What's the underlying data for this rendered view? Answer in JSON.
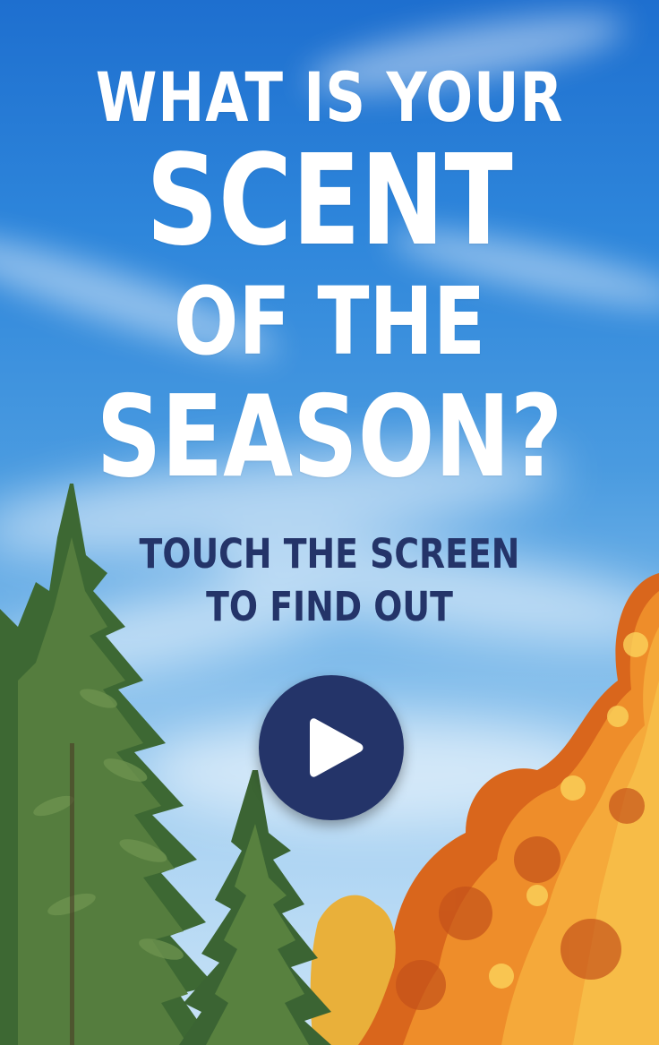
{
  "headline": {
    "line1": "WHAT IS YOUR",
    "line2": "SCENT",
    "line3": "OF THE",
    "line4": "SEASON?"
  },
  "cta": {
    "line1": "TOUCH THE SCREEN",
    "line2": "TO FIND OUT"
  },
  "play_button": {
    "icon": "play-icon"
  },
  "colors": {
    "sky_top": "#1e6fcf",
    "sky_bottom": "#c9e3f7",
    "headline": "#ffffff",
    "cta_text": "#243469",
    "play_button": "#243469",
    "evergreen": "#3f6b35",
    "autumn_orange": "#e8892a"
  }
}
